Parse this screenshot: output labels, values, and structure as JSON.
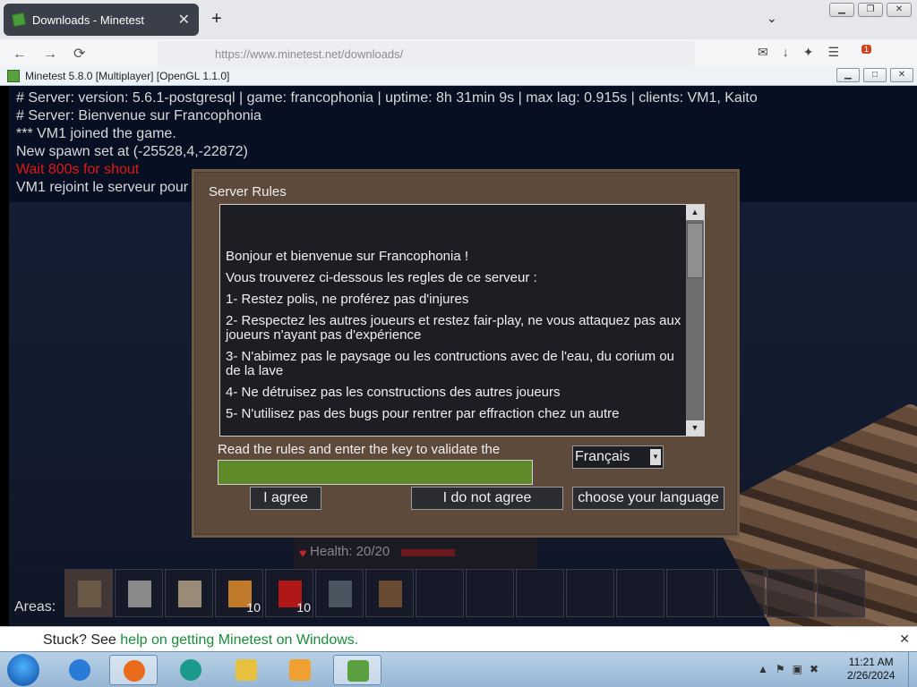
{
  "browser": {
    "tab_title": "Downloads - Minetest",
    "tab_close": "✕",
    "new_tab": "+",
    "tab_list": "⌄",
    "url": "https://www.minetest.net/downloads/",
    "extensions_badge": "1"
  },
  "minetest": {
    "window_title": "Minetest 5.8.0 [Multiplayer] [OpenGL 1.1.0]",
    "chat": [
      {
        "text": "# Server: version: 5.6.1-postgresql | game: francophonia | uptime: 8h 31min 9s | max lag: 0.915s | clients: VM1, Kaito",
        "warn": false
      },
      {
        "text": "# Server: Bienvenue sur Francophonia",
        "warn": false
      },
      {
        "text": "*** VM1 joined the game.",
        "warn": false
      },
      {
        "text": "New spawn set at (-25528,4,-22872)",
        "warn": false
      },
      {
        "text": "Wait 800s for shout",
        "warn": true
      },
      {
        "text": "VM1 rejoint le serveur pour",
        "warn": false
      }
    ],
    "dialog": {
      "title": "Server Rules",
      "rules": [
        "Bonjour et bienvenue sur Francophonia !",
        "Vous trouverez ci-dessous les regles de ce serveur :",
        "1- Restez polis, ne proférez pas d'injures",
        "2- Respectez les autres joueurs et restez fair-play, ne vous attaquez pas aux joueurs n'ayant pas d'expérience",
        "3- N'abimez pas le paysage ou les contructions avec de l'eau, du corium ou de la lave",
        "4- Ne détruisez pas les constructions des autres joueurs",
        "5- N'utilisez pas des bugs pour rentrer par effraction chez un autre"
      ],
      "key_label": "Read the rules and enter the key to validate the",
      "key_value": "",
      "language_selected": "Français",
      "buttons": {
        "agree": "I agree",
        "disagree": "I do not agree",
        "language": "choose your language"
      }
    },
    "hud": {
      "health": "Health: 20/20",
      "areas": "Areas:",
      "hotbar": [
        {
          "item": "pickaxe",
          "count": "",
          "color": "#6b5a48"
        },
        {
          "item": "axe",
          "count": "",
          "color": "#8a8a8a"
        },
        {
          "item": "shovel",
          "count": "",
          "color": "#9a8a78"
        },
        {
          "item": "torch",
          "count": "10",
          "color": "#c07a2a"
        },
        {
          "item": "apple",
          "count": "10",
          "color": "#b01818"
        },
        {
          "item": "steel-block",
          "count": "",
          "color": "#4a5560"
        },
        {
          "item": "furnace-block",
          "count": "",
          "color": "#6a4a30"
        },
        {
          "item": "",
          "count": "",
          "color": ""
        },
        {
          "item": "",
          "count": "",
          "color": ""
        },
        {
          "item": "",
          "count": "",
          "color": ""
        },
        {
          "item": "",
          "count": "",
          "color": ""
        },
        {
          "item": "",
          "count": "",
          "color": ""
        },
        {
          "item": "",
          "count": "",
          "color": ""
        },
        {
          "item": "",
          "count": "",
          "color": ""
        },
        {
          "item": "",
          "count": "",
          "color": ""
        },
        {
          "item": "",
          "count": "",
          "color": ""
        }
      ]
    }
  },
  "footer_bar": {
    "prefix": "Stuck? See ",
    "link": "help on getting Minetest on Windows."
  },
  "taskbar": {
    "time": "11:21 AM",
    "date": "2/26/2024",
    "apps": [
      "internet-explorer",
      "firefox",
      "edge",
      "file-explorer",
      "media-player",
      "minetest"
    ]
  }
}
